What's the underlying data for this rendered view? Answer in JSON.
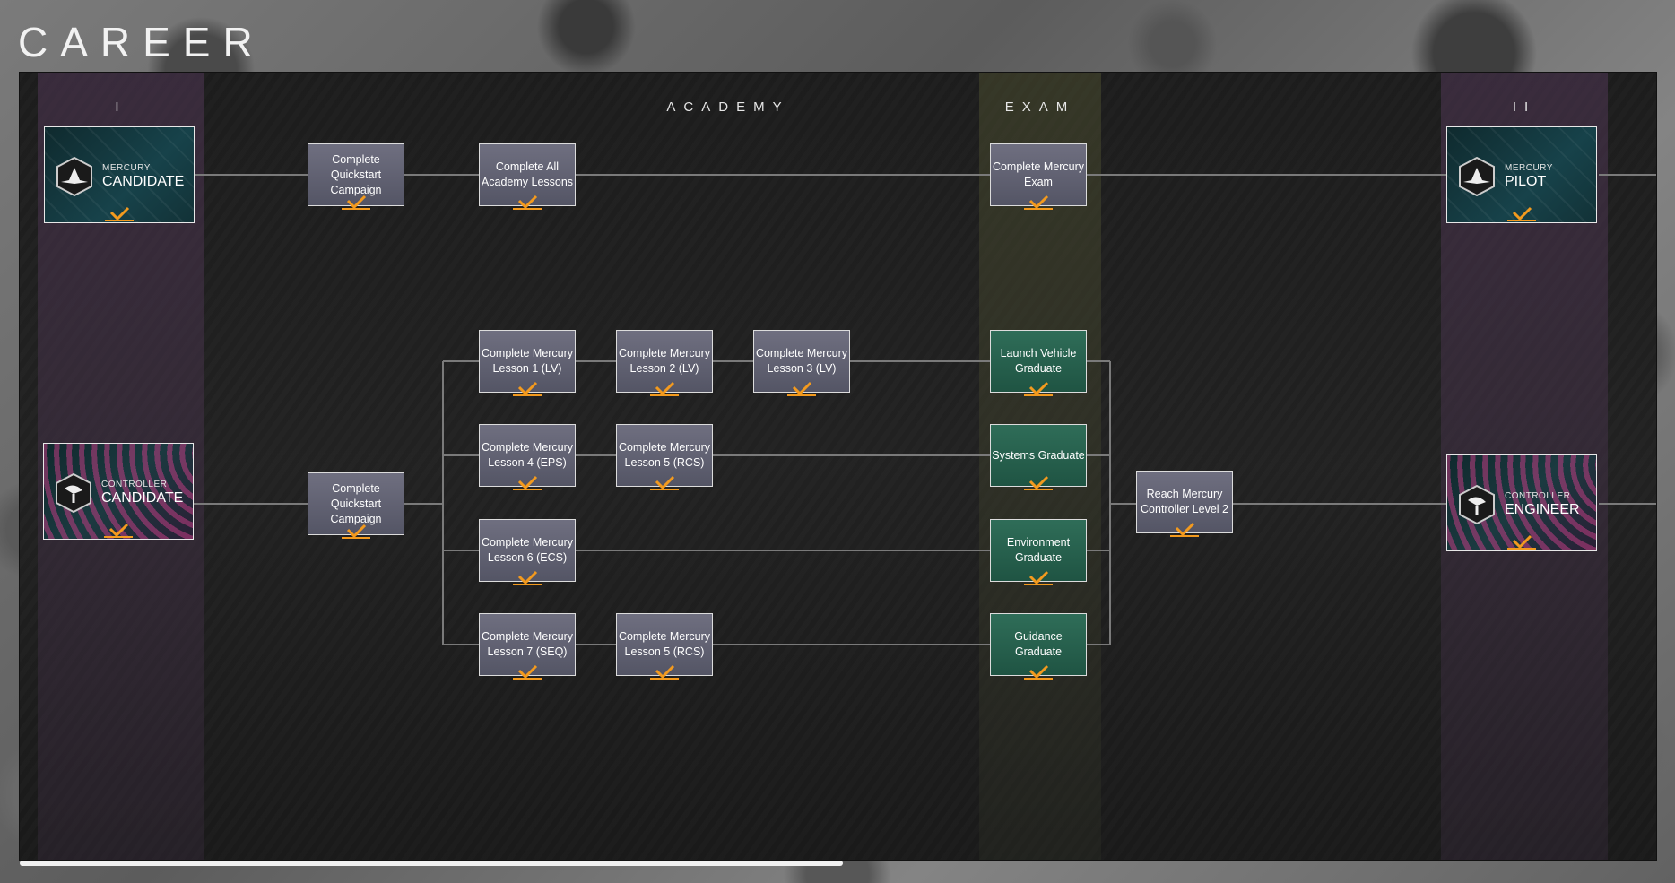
{
  "title": "CAREER",
  "headers": {
    "tier1": "I",
    "academy": "ACADEMY",
    "exam": "EXAM",
    "tier2": "II"
  },
  "ranks": {
    "mercury_candidate": {
      "small": "MERCURY",
      "big": "CANDIDATE"
    },
    "controller_candidate": {
      "small": "CONTROLLER",
      "big": "CANDIDATE"
    },
    "mercury_pilot": {
      "small": "MERCURY",
      "big": "PILOT"
    },
    "controller_engineer": {
      "small": "CONTROLLER",
      "big": "ENGINEER"
    }
  },
  "nodes": {
    "quickstart_top": "Complete Quickstart Campaign",
    "all_academy": "Complete All Academy Lessons",
    "mercury_exam": "Complete Mercury Exam",
    "quickstart_bottom": "Complete Quickstart Campaign",
    "lesson1": "Complete Mercury Lesson 1 (LV)",
    "lesson2": "Complete Mercury Lesson 2 (LV)",
    "lesson3": "Complete Mercury Lesson 3 (LV)",
    "lesson4": "Complete Mercury Lesson 4 (EPS)",
    "lesson5a": "Complete Mercury Lesson 5 (RCS)",
    "lesson6": "Complete Mercury Lesson 6 (ECS)",
    "lesson7": "Complete Mercury Lesson 7 (SEQ)",
    "lesson5b": "Complete Mercury Lesson 5 (RCS)",
    "lv_grad": "Launch Vehicle Graduate",
    "sys_grad": "Systems Graduate",
    "env_grad": "Environment Graduate",
    "guid_grad": "Guidance Graduate",
    "controller_lvl2": "Reach Mercury Controller Level 2"
  },
  "colors": {
    "check": "#f39a1e",
    "node_default": "#5f6070",
    "node_graduate": "#276150",
    "wire": "#7a7a7a"
  }
}
